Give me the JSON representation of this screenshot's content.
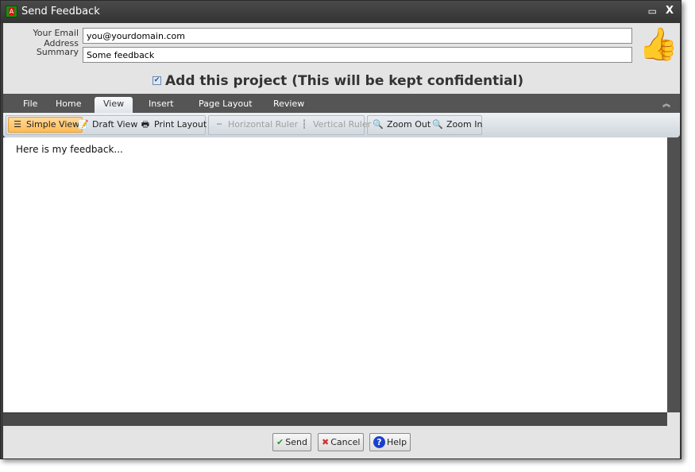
{
  "window": {
    "title": "Send Feedback",
    "icon": "app-icon",
    "maximize": "▭",
    "close": "X"
  },
  "form": {
    "email_label": "Your Email Address",
    "email_value": "you@yourdomain.com",
    "summary_label": "Summary",
    "summary_value": "Some feedback",
    "add_project_label": "Add this project (This will be kept confidential)",
    "add_project_checked": true
  },
  "ribbon": {
    "tabs": [
      {
        "label": "File"
      },
      {
        "label": "Home"
      },
      {
        "label": "View",
        "active": true
      },
      {
        "label": "Insert"
      },
      {
        "label": "Page Layout"
      },
      {
        "label": "Review"
      }
    ],
    "buttons": {
      "simple_view": "Simple View",
      "draft_view": "Draft View",
      "print_layout": "Print Layout",
      "horizontal_ruler": "Horizontal Ruler",
      "vertical_ruler": "Vertical Ruler",
      "zoom_out": "Zoom Out",
      "zoom_in": "Zoom In"
    }
  },
  "editor": {
    "content": "Here is my feedback..."
  },
  "footer": {
    "send": "Send",
    "cancel": "Cancel",
    "help": "Help"
  }
}
